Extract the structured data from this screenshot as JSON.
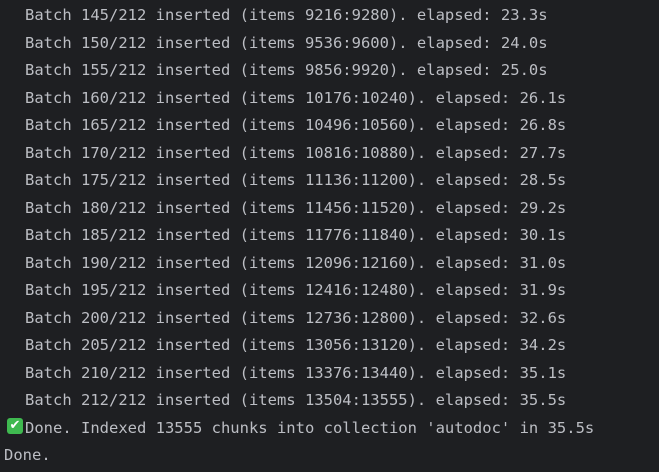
{
  "terminal": {
    "batch_lines": [
      "Batch 145/212 inserted (items 9216:9280). elapsed: 23.3s",
      "Batch 150/212 inserted (items 9536:9600). elapsed: 24.0s",
      "Batch 155/212 inserted (items 9856:9920). elapsed: 25.0s",
      "Batch 160/212 inserted (items 10176:10240). elapsed: 26.1s",
      "Batch 165/212 inserted (items 10496:10560). elapsed: 26.8s",
      "Batch 170/212 inserted (items 10816:10880). elapsed: 27.7s",
      "Batch 175/212 inserted (items 11136:11200). elapsed: 28.5s",
      "Batch 180/212 inserted (items 11456:11520). elapsed: 29.2s",
      "Batch 185/212 inserted (items 11776:11840). elapsed: 30.1s",
      "Batch 190/212 inserted (items 12096:12160). elapsed: 31.0s",
      "Batch 195/212 inserted (items 12416:12480). elapsed: 31.9s",
      "Batch 200/212 inserted (items 12736:12800). elapsed: 32.6s",
      "Batch 205/212 inserted (items 13056:13120). elapsed: 34.2s",
      "Batch 210/212 inserted (items 13376:13440). elapsed: 35.1s",
      "Batch 212/212 inserted (items 13504:13555). elapsed: 35.5s"
    ],
    "summary_icon": "check-mark-icon",
    "summary_icon_glyph": "✔",
    "summary_text": "Done. Indexed 13555 chunks into collection 'autodoc' in 35.5s",
    "final_text": "Done."
  },
  "colors": {
    "background": "#1e1f22",
    "text": "#bcbec4",
    "check_green": "#3fb950"
  }
}
